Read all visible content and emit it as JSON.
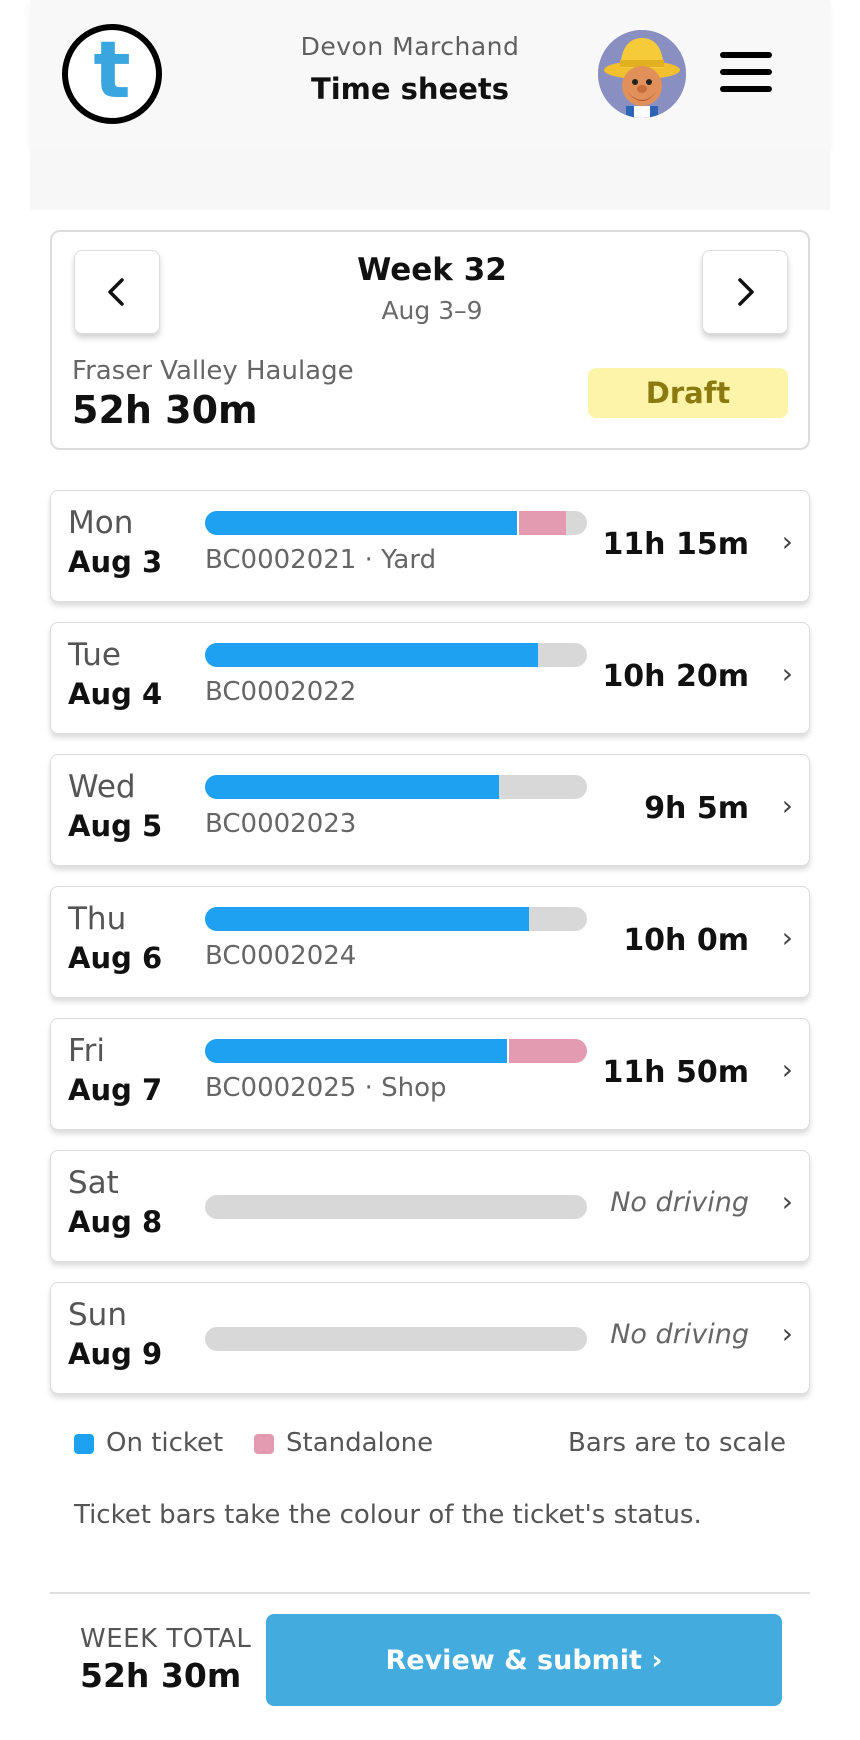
{
  "header": {
    "logo_letter": "t",
    "user_name": "Devon Marchand",
    "title": "Time sheets"
  },
  "week": {
    "title": "Week 32",
    "range": "Aug 3–9",
    "company": "Fraser Valley Haulage",
    "total": "52h 30m",
    "status": "Draft"
  },
  "colors": {
    "on_ticket": "#1ea1f1",
    "standalone": "#e39bb2",
    "bar_empty": "#d8d8d8",
    "badge_bg": "#fdf4a9",
    "submit_bg": "#43abdd"
  },
  "days": [
    {
      "name": "Mon",
      "date": "Aug 3",
      "ticket": "BC0002021 · Yard",
      "hours": "11h 15m",
      "ticket_frac": 0.818,
      "standalone_frac": 0.127
    },
    {
      "name": "Tue",
      "date": "Aug 4",
      "ticket": "BC0002022",
      "hours": "10h 20m",
      "ticket_frac": 0.871,
      "standalone_frac": 0
    },
    {
      "name": "Wed",
      "date": "Aug 5",
      "ticket": "BC0002023",
      "hours": "9h 5m",
      "ticket_frac": 0.77,
      "standalone_frac": 0
    },
    {
      "name": "Thu",
      "date": "Aug 6",
      "ticket": "BC0002024",
      "hours": "10h 0m",
      "ticket_frac": 0.848,
      "standalone_frac": 0
    },
    {
      "name": "Fri",
      "date": "Aug 7",
      "ticket": "BC0002025 · Shop",
      "hours": "11h 50m",
      "ticket_frac": 0.79,
      "standalone_frac": 0.21
    },
    {
      "name": "Sat",
      "date": "Aug 8",
      "ticket": "",
      "hours": "No driving",
      "ticket_frac": 0,
      "standalone_frac": 0
    },
    {
      "name": "Sun",
      "date": "Aug 9",
      "ticket": "",
      "hours": "No driving",
      "ticket_frac": 0,
      "standalone_frac": 0
    }
  ],
  "legend": {
    "on_ticket": "On ticket",
    "standalone": "Standalone",
    "note": "Bars are to scale",
    "caption": "Ticket bars take the colour of the ticket's status."
  },
  "footer": {
    "total_label": "WEEK TOTAL",
    "total_value": "52h 30m",
    "submit_label": "Review & submit ›"
  },
  "icons": {
    "prev": "chevron-left-icon",
    "next": "chevron-right-icon",
    "row_chevron": "›"
  }
}
